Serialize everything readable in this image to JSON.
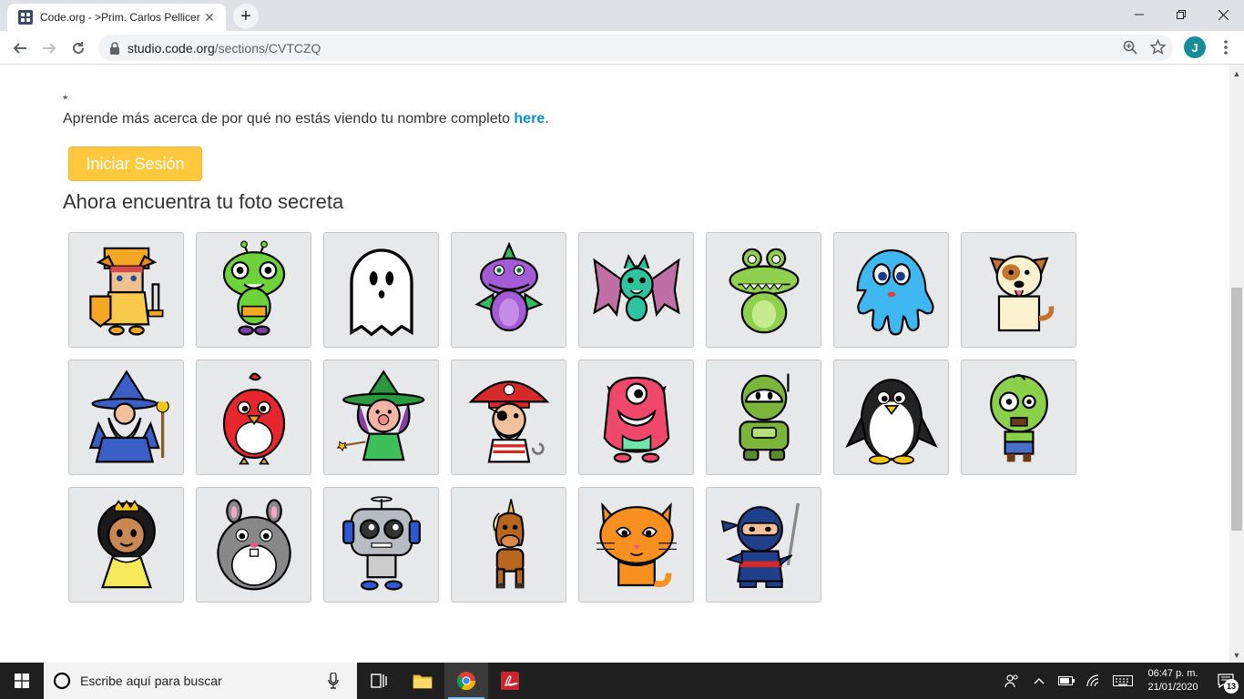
{
  "browser": {
    "tab": {
      "title": "Code.org - >Prim. Carlos Pellicer",
      "close_glyph": "✕"
    },
    "new_tab_glyph": "+",
    "url": {
      "host": "studio.code.org",
      "path": "/sections/CVTCZQ"
    },
    "profile_initial": "J"
  },
  "page": {
    "asterisk": "*",
    "info_text": "Aprende más acerca de por qué no estás viendo tu nombre completo ",
    "info_link": "here",
    "info_end": ".",
    "signin_label": "Iniciar Sesión",
    "heading": "Ahora encuentra tu foto secreta",
    "pictures": [
      {
        "name": "knight",
        "icon": "knight-icon"
      },
      {
        "name": "alien",
        "icon": "alien-icon"
      },
      {
        "name": "ghost",
        "icon": "ghost-icon"
      },
      {
        "name": "dragon",
        "icon": "dragon-icon"
      },
      {
        "name": "bat",
        "icon": "bat-icon"
      },
      {
        "name": "crocodile",
        "icon": "crocodile-icon"
      },
      {
        "name": "octopus",
        "icon": "octopus-icon"
      },
      {
        "name": "dog",
        "icon": "dog-icon"
      },
      {
        "name": "wizard",
        "icon": "wizard-icon"
      },
      {
        "name": "bird",
        "icon": "bird-icon"
      },
      {
        "name": "witch",
        "icon": "witch-icon"
      },
      {
        "name": "pirate",
        "icon": "pirate-icon"
      },
      {
        "name": "monster",
        "icon": "monster-icon"
      },
      {
        "name": "robot-green",
        "icon": "green-robot-icon"
      },
      {
        "name": "penguin",
        "icon": "penguin-icon"
      },
      {
        "name": "zombie",
        "icon": "zombie-icon"
      },
      {
        "name": "princess",
        "icon": "princess-icon"
      },
      {
        "name": "hamster",
        "icon": "hamster-icon"
      },
      {
        "name": "robot",
        "icon": "robot-icon"
      },
      {
        "name": "unicorn",
        "icon": "unicorn-icon"
      },
      {
        "name": "cat",
        "icon": "cat-icon"
      },
      {
        "name": "ninja",
        "icon": "ninja-icon"
      }
    ]
  },
  "taskbar": {
    "search_placeholder": "Escribe aquí para buscar",
    "clock_time": "06:47 p. m.",
    "clock_date": "21/01/2020",
    "notifications": "13"
  }
}
